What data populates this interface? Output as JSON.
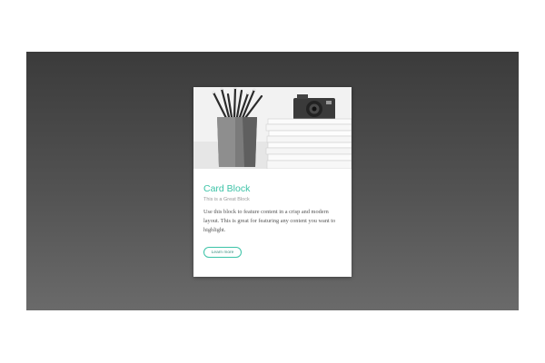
{
  "card": {
    "title": "Card Block",
    "subtitle": "This is a Great Block",
    "body": "Use this block to feature content in a crisp and modern layout. This is great for featuring any content you want to highlight.",
    "button_label": "Learn more",
    "image_icon": "pencils-and-camera-photo"
  },
  "colors": {
    "accent": "#3cc3a7",
    "stage_top": "#3b3b3b",
    "stage_bottom": "#6a6a6a"
  }
}
